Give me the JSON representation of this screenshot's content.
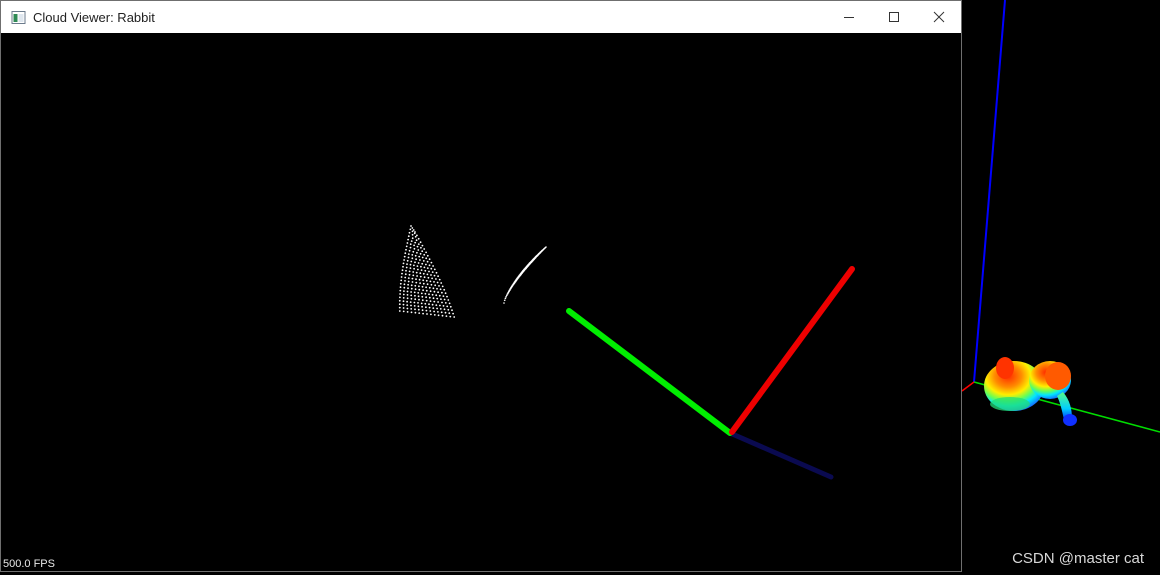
{
  "window": {
    "title": "Cloud Viewer: Rabbit",
    "icon": "app-window-icon",
    "controls": [
      "minimize-icon",
      "maximize-icon",
      "close-icon"
    ]
  },
  "viewport": {
    "fps_label": "500.0 FPS",
    "axes": {
      "x_color": "#ff0000",
      "y_color": "#00ff00",
      "z_color": "#0a0a50"
    },
    "point_color": "#ffffff"
  },
  "background_view": {
    "axes": {
      "x_color": "#ff0000",
      "y_color": "#00ff00",
      "z_color": "#0000ff"
    },
    "cloud_colormap": "jet"
  },
  "watermark": "CSDN @master cat"
}
